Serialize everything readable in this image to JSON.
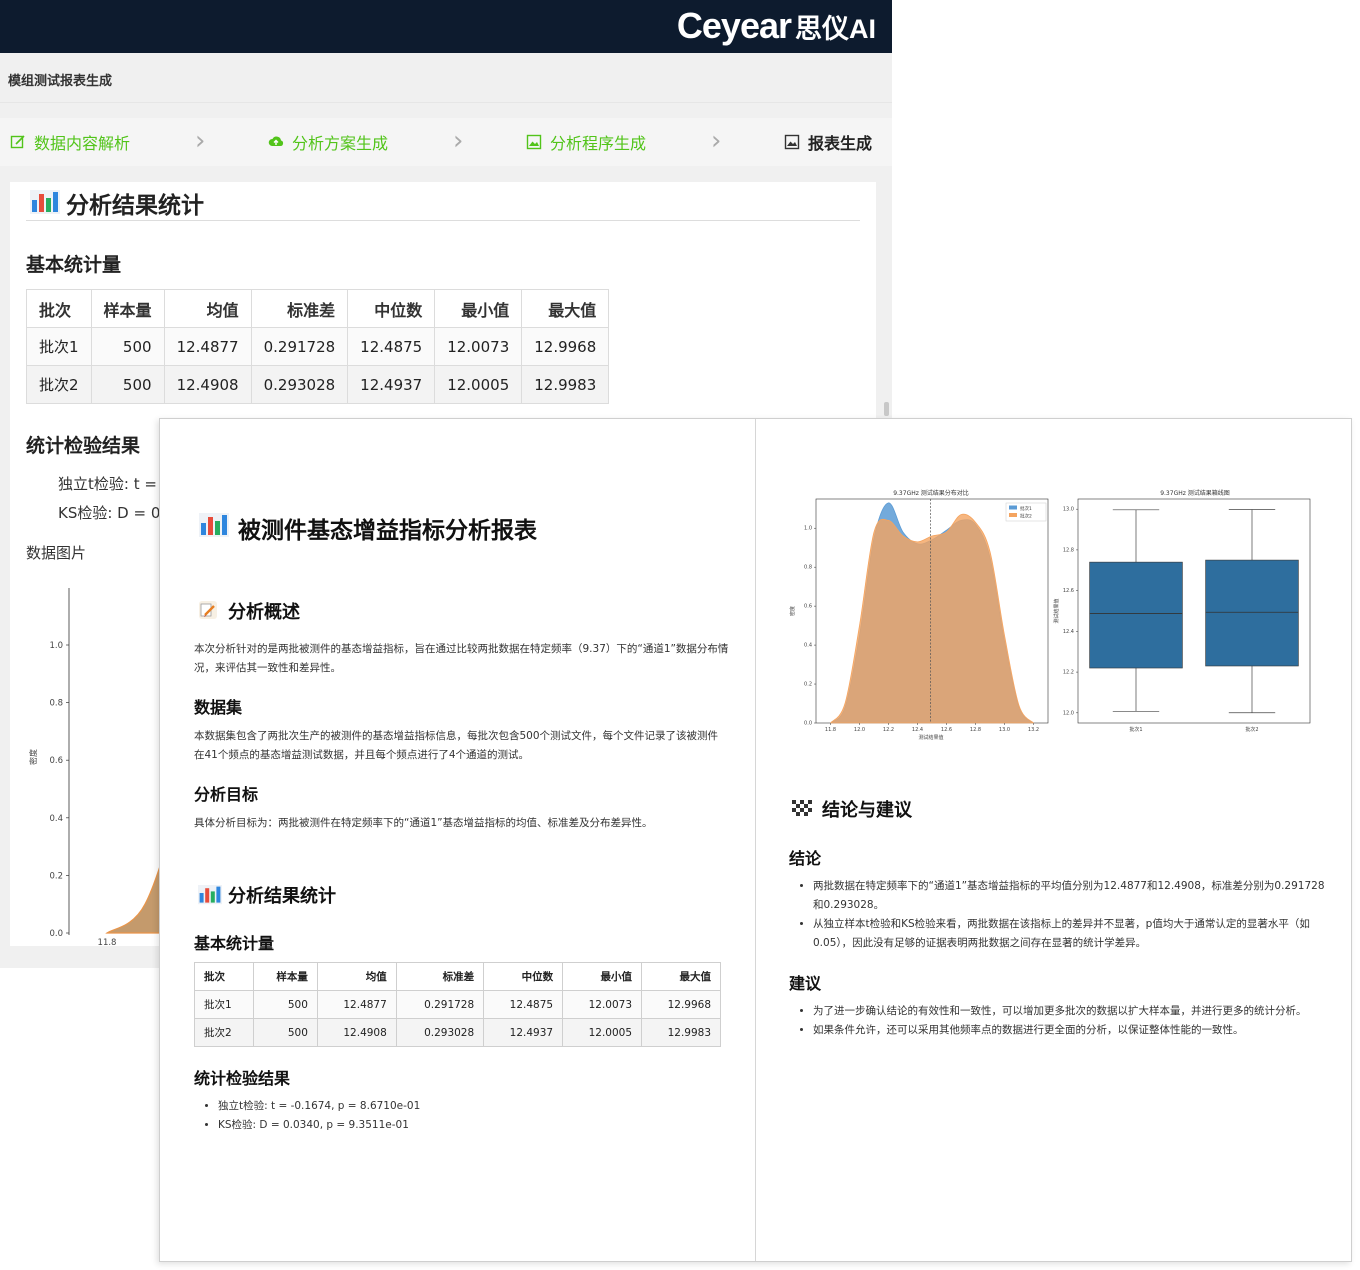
{
  "app": {
    "brand_latin": "Ceyear",
    "brand_cn": "思仪AI",
    "title": "模组测试报表生成",
    "steps": [
      {
        "label": "数据内容解析",
        "icon": "edit-icon",
        "state": "done"
      },
      {
        "label": "分析方案生成",
        "icon": "cloud-icon",
        "state": "done"
      },
      {
        "label": "分析程序生成",
        "icon": "image-icon",
        "state": "done"
      },
      {
        "label": "报表生成",
        "icon": "image-icon",
        "state": "active"
      }
    ],
    "accent_color": "#52c41a",
    "panel": {
      "section_title": "分析结果统计",
      "basic_stats_heading": "基本统计量",
      "test_results_heading": "统计检验结果",
      "ttest_partial": "独立t检验: t =",
      "ks_partial": "KS检验: D = 0",
      "data_image_label": "数据图片",
      "chart_ylabel": "密度",
      "chart_yticks": [
        "0.0",
        "0.2",
        "0.4",
        "0.6",
        "0.8",
        "1.0"
      ],
      "chart_xticks": [
        "11.8",
        "12.0"
      ]
    }
  },
  "stats_table": {
    "headers": [
      "批次",
      "样本量",
      "均值",
      "标准差",
      "中位数",
      "最小值",
      "最大值"
    ],
    "rows": [
      [
        "批次1",
        "500",
        "12.4877",
        "0.291728",
        "12.4875",
        "12.0073",
        "12.9968"
      ],
      [
        "批次2",
        "500",
        "12.4908",
        "0.293028",
        "12.4937",
        "12.0005",
        "12.9983"
      ]
    ]
  },
  "report": {
    "title": "被测件基态增益指标分析报表",
    "overview_heading": "分析概述",
    "overview_text": "本次分析针对的是两批被测件的基态增益指标，旨在通过比较两批数据在特定频率（9.37）下的“通道1”数据分布情况，来评估其一致性和差异性。",
    "dataset_heading": "数据集",
    "dataset_text": "本数据集包含了两批次生产的被测件的基态增益指标信息，每批次包含500个测试文件，每个文件记录了该被测件在41个频点的基态增益测试数据，并且每个频点进行了4个通道的测试。",
    "goal_heading": "分析目标",
    "goal_text": "具体分析目标为：两批被测件在特定频率下的“通道1”基态增益指标的均值、标准差及分布差异性。",
    "results_heading": "分析结果统计",
    "basic_stats_heading": "基本统计量",
    "test_heading": "统计检验结果",
    "test_items": [
      "独立t检验: t = -0.1674, p = 8.6710e-01",
      "KS检验: D = 0.0340, p = 9.3511e-01"
    ],
    "conclusion_section": "结论与建议",
    "conclusion_heading": "结论",
    "conclusions": [
      "两批数据在特定频率下的“通道1”基态增益指标的平均值分别为12.4877和12.4908，标准差分别为0.291728和0.293028。",
      "从独立样本t检验和KS检验来看，两批数据在该指标上的差异并不显著，p值均大于通常认定的显著水平（如0.05），因此没有足够的证据表明两批数据之间存在显著的统计学差异。"
    ],
    "suggestion_heading": "建议",
    "suggestions": [
      "为了进一步确认结论的有效性和一致性，可以增加更多批次的数据以扩大样本量，并进行更多的统计分析。",
      "如果条件允许，还可以采用其他频率点的数据进行更全面的分析，以保证整体性能的一致性。"
    ]
  },
  "chart_data": [
    {
      "type": "area",
      "title": "9.37GHz 测试结果分布对比",
      "xlabel": "测试结果值",
      "ylabel": "密度",
      "xlim": [
        11.7,
        13.3
      ],
      "ylim": [
        0.0,
        1.15
      ],
      "xticks": [
        "11.8",
        "12.0",
        "12.2",
        "12.4",
        "12.6",
        "12.8",
        "13.0",
        "13.2"
      ],
      "yticks": [
        "0.0",
        "0.2",
        "0.4",
        "0.6",
        "0.8",
        "1.0"
      ],
      "legend": "top-right",
      "mean_line_x": 12.49,
      "x": [
        11.8,
        11.9,
        12.0,
        12.1,
        12.2,
        12.3,
        12.4,
        12.5,
        12.6,
        12.7,
        12.8,
        12.9,
        13.0,
        13.1,
        13.2
      ],
      "series": [
        {
          "name": "批次1",
          "color": "#5b9bd5",
          "values": [
            0.0,
            0.08,
            0.45,
            0.95,
            1.13,
            0.98,
            0.92,
            0.94,
            0.99,
            1.04,
            1.02,
            0.85,
            0.42,
            0.08,
            0.0
          ]
        },
        {
          "name": "批次2",
          "color": "#f4a460",
          "values": [
            0.0,
            0.1,
            0.5,
            0.98,
            1.04,
            0.96,
            0.93,
            0.96,
            0.98,
            1.07,
            1.03,
            0.88,
            0.45,
            0.09,
            0.0
          ]
        }
      ]
    },
    {
      "type": "boxplot",
      "title": "9.37GHz 测试结果箱线图",
      "ylabel": "测试结果值",
      "ylim": [
        11.95,
        13.05
      ],
      "yticks": [
        "12.0",
        "12.2",
        "12.4",
        "12.6",
        "12.8",
        "13.0"
      ],
      "categories": [
        "批次1",
        "批次2"
      ],
      "boxes": [
        {
          "min": 12.0073,
          "q1": 12.22,
          "median": 12.4875,
          "q3": 12.74,
          "max": 12.9968
        },
        {
          "min": 12.0005,
          "q1": 12.23,
          "median": 12.4937,
          "q3": 12.75,
          "max": 12.9983
        }
      ],
      "box_color": "#2e6e9e"
    }
  ]
}
